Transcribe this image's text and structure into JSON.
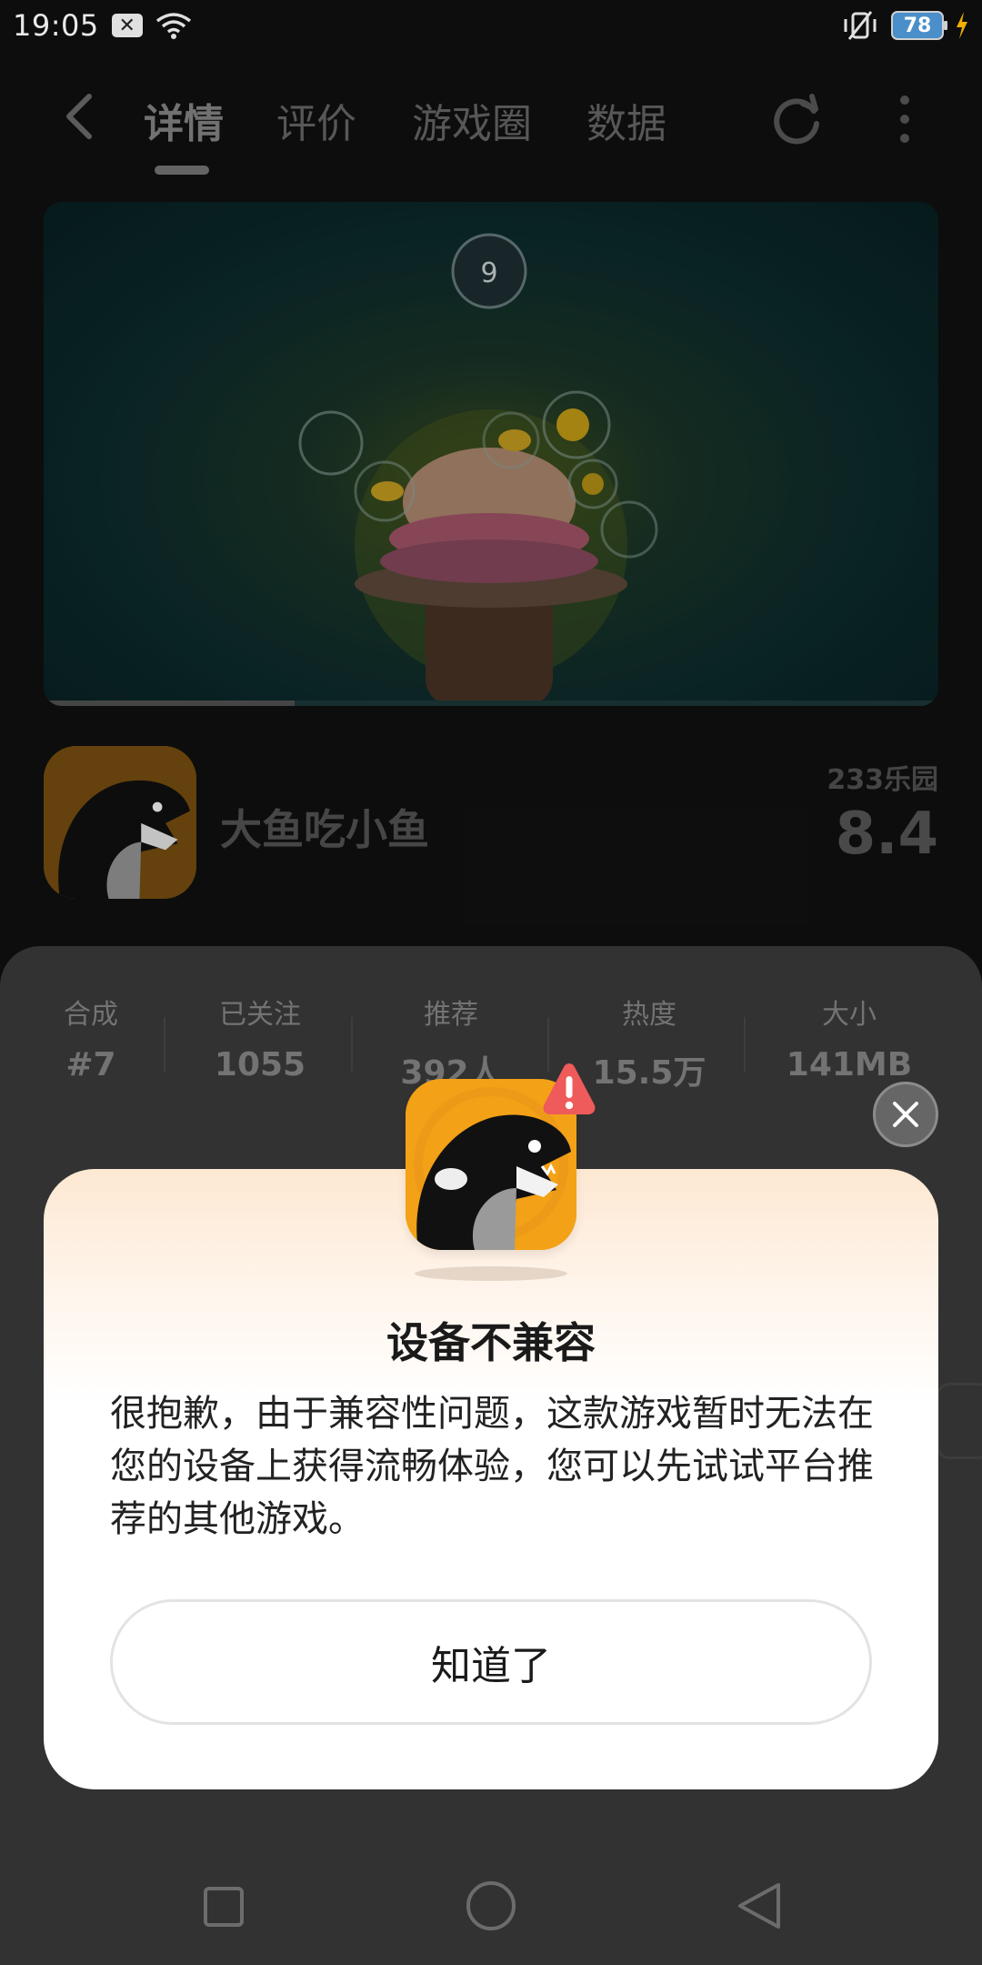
{
  "status_bar": {
    "time": "19:05",
    "battery": "78",
    "notif_icon": "close-box-icon",
    "wifi_icon": "wifi-icon",
    "vibrate_icon": "vibrate-icon"
  },
  "nav": {
    "tabs": [
      {
        "label": "详情",
        "active": true
      },
      {
        "label": "评价",
        "active": false
      },
      {
        "label": "游戏圈",
        "active": false
      },
      {
        "label": "数据",
        "active": false
      }
    ]
  },
  "game": {
    "name": "大鱼吃小鱼",
    "rating_source": "233乐园",
    "rating": "8.4",
    "video_timer": "9",
    "video_progress": 0.28
  },
  "stats": [
    {
      "label": "合成",
      "value": "#7"
    },
    {
      "label": "已关注",
      "value": "1055"
    },
    {
      "label": "推荐",
      "value": "392人"
    },
    {
      "label": "热度",
      "value": "15.5万"
    },
    {
      "label": "大小",
      "value": "141MB"
    }
  ],
  "dialog": {
    "title": "设备不兼容",
    "body": "很抱歉，由于兼容性问题，这款游戏暂时无法在您的设备上获得流畅体验，您可以先试试平台推荐的其他游戏。",
    "ok_label": "知道了"
  },
  "colors": {
    "dialog_bg": "#ffffff",
    "warn_badge": "#ef5a5a",
    "icon_bg": "#f3a116"
  }
}
